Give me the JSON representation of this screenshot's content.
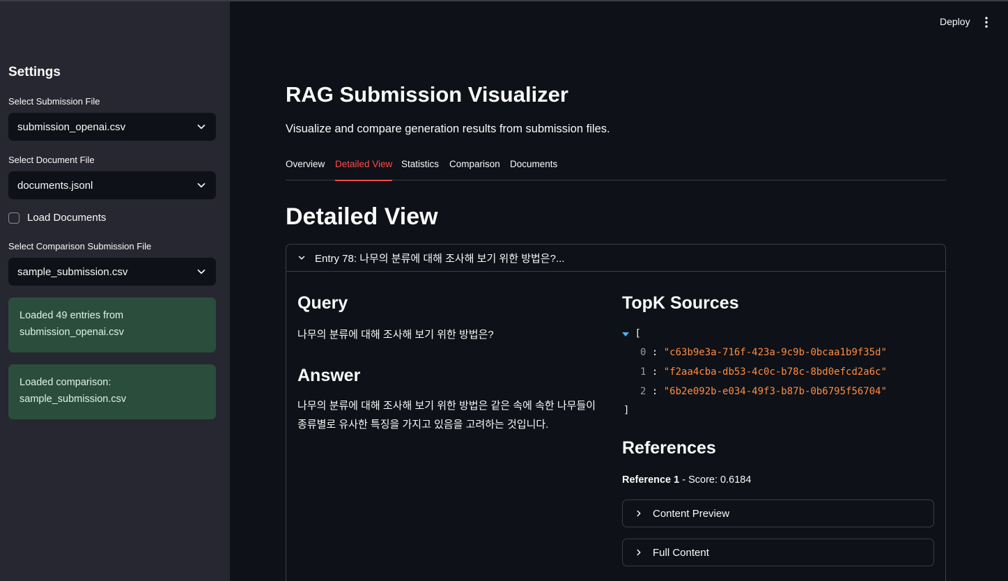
{
  "sidebar": {
    "title": "Settings",
    "submission_label": "Select Submission File",
    "submission_value": "submission_openai.csv",
    "document_label": "Select Document File",
    "document_value": "documents.jsonl",
    "load_documents_label": "Load Documents",
    "load_documents_checked": false,
    "comparison_label": "Select Comparison Submission File",
    "comparison_value": "sample_submission.csv",
    "alerts": [
      {
        "line1": "Loaded 49 entries from",
        "line2": "submission_openai.csv"
      },
      {
        "line1": "Loaded comparison:",
        "line2": "sample_submission.csv"
      }
    ]
  },
  "header": {
    "deploy_label": "Deploy"
  },
  "main": {
    "title": "RAG Submission Visualizer",
    "subtitle": "Visualize and compare generation results from submission files.",
    "tabs": [
      {
        "label": "Overview"
      },
      {
        "label": "Detailed View"
      },
      {
        "label": "Statistics"
      },
      {
        "label": "Comparison"
      },
      {
        "label": "Documents"
      }
    ],
    "active_tab": "Detailed View",
    "section_title": "Detailed View",
    "entry": {
      "header": "Entry 78: 나무의 분류에 대해 조사해 보기 위한 방법은?...",
      "query_title": "Query",
      "query_text": "나무의 분류에 대해 조사해 보기 위한 방법은?",
      "answer_title": "Answer",
      "answer_line1": "나무의 분류에 대해 조사해 보기 위한 방법은 같은 속에 속한 나무들이",
      "answer_line2": "종류별로 유사한 특징을 가지고 있음을 고려하는 것입니다.",
      "topk_title": "TopK Sources",
      "json_open": "[",
      "json_close": "]",
      "topk": [
        {
          "index": "0",
          "value": "\"c63b9e3a-716f-423a-9c9b-0bcaa1b9f35d\""
        },
        {
          "index": "1",
          "value": "\"f2aa4cba-db53-4c0c-b78c-8bd0efcd2a6c\""
        },
        {
          "index": "2",
          "value": "\"6b2e092b-e034-49f3-b87b-0b6795f56704\""
        }
      ],
      "references_title": "References",
      "reference_label": "Reference 1",
      "reference_score": " - Score: 0.6184",
      "content_preview_label": "Content Preview",
      "full_content_label": "Full Content"
    }
  },
  "colors": {
    "accent": "#ff4b4b",
    "sidebar_bg": "#262730",
    "main_bg": "#0e1117",
    "success_bg": "#2b4d3c",
    "json_string": "#ff8c42"
  }
}
